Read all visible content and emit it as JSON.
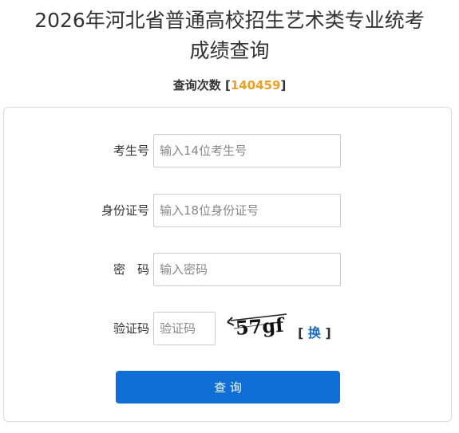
{
  "title": {
    "line1": "2026年河北省普通高校招生艺术类专业统考",
    "line2": "成绩查询"
  },
  "counter": {
    "label": "查询次数",
    "open": "[",
    "value": "140459",
    "close": "]"
  },
  "form": {
    "exam_no": {
      "label": "考生号",
      "placeholder": "输入14位考生号"
    },
    "id_no": {
      "label": "身份证号",
      "placeholder": "输入18位身份证号"
    },
    "password": {
      "label": "密　码",
      "placeholder": "输入密码"
    },
    "captcha": {
      "label": "验证码",
      "placeholder": "验证码",
      "image_text": "57gf",
      "refresh_open": "[",
      "refresh_label": "换",
      "refresh_close": "]"
    },
    "submit_label": "查 询"
  },
  "colors": {
    "accent": "#0f6fd6",
    "counter_number": "#f0a020",
    "link": "#1a6fc4"
  }
}
